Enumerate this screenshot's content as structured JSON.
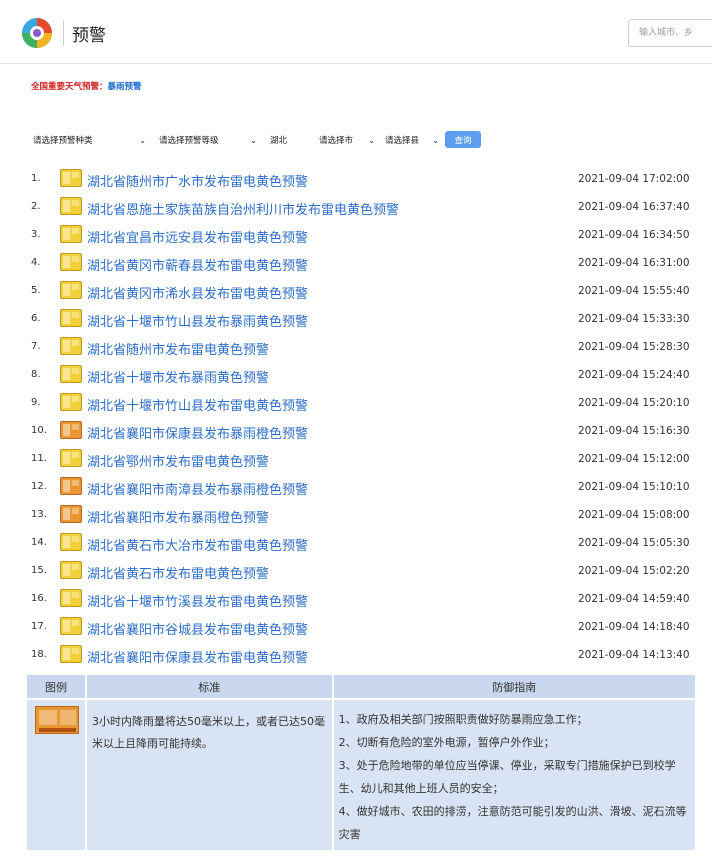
{
  "header": {
    "title": "预警",
    "search_placeholder": "输入城市、乡"
  },
  "national": {
    "label": "全国重要天气预警：",
    "link": "暴雨预警"
  },
  "filters": {
    "type": "请选择预警种类",
    "level": "请选择预警等级",
    "province": "湖北",
    "city": "请选择市",
    "county": "请选择县",
    "query": "查询"
  },
  "alerts": [
    {
      "num": "1.",
      "title": "湖北省随州市广水市发布雷电黄色预警",
      "time": "2021-09-04 17:02:00",
      "color": "yellow"
    },
    {
      "num": "2.",
      "title": "湖北省恩施土家族苗族自治州利川市发布雷电黄色预警",
      "time": "2021-09-04 16:37:40",
      "color": "yellow"
    },
    {
      "num": "3.",
      "title": "湖北省宜昌市远安县发布雷电黄色预警",
      "time": "2021-09-04 16:34:50",
      "color": "yellow"
    },
    {
      "num": "4.",
      "title": "湖北省黄冈市蕲春县发布雷电黄色预警",
      "time": "2021-09-04 16:31:00",
      "color": "yellow"
    },
    {
      "num": "5.",
      "title": "湖北省黄冈市浠水县发布雷电黄色预警",
      "time": "2021-09-04 15:55:40",
      "color": "yellow"
    },
    {
      "num": "6.",
      "title": "湖北省十堰市竹山县发布暴雨黄色预警",
      "time": "2021-09-04 15:33:30",
      "color": "yellow"
    },
    {
      "num": "7.",
      "title": "湖北省随州市发布雷电黄色预警",
      "time": "2021-09-04 15:28:30",
      "color": "yellow"
    },
    {
      "num": "8.",
      "title": "湖北省十堰市发布暴雨黄色预警",
      "time": "2021-09-04 15:24:40",
      "color": "yellow"
    },
    {
      "num": "9.",
      "title": "湖北省十堰市竹山县发布雷电黄色预警",
      "time": "2021-09-04 15:20:10",
      "color": "yellow"
    },
    {
      "num": "10.",
      "title": "湖北省襄阳市保康县发布暴雨橙色预警",
      "time": "2021-09-04 15:16:30",
      "color": "orange"
    },
    {
      "num": "11.",
      "title": "湖北省鄂州市发布雷电黄色预警",
      "time": "2021-09-04 15:12:00",
      "color": "yellow"
    },
    {
      "num": "12.",
      "title": "湖北省襄阳市南漳县发布暴雨橙色预警",
      "time": "2021-09-04 15:10:10",
      "color": "orange"
    },
    {
      "num": "13.",
      "title": "湖北省襄阳市发布暴雨橙色预警",
      "time": "2021-09-04 15:08:00",
      "color": "orange"
    },
    {
      "num": "14.",
      "title": "湖北省黄石市大冶市发布雷电黄色预警",
      "time": "2021-09-04 15:05:30",
      "color": "yellow"
    },
    {
      "num": "15.",
      "title": "湖北省黄石市发布雷电黄色预警",
      "time": "2021-09-04 15:02:20",
      "color": "yellow"
    },
    {
      "num": "16.",
      "title": "湖北省十堰市竹溪县发布雷电黄色预警",
      "time": "2021-09-04 14:59:40",
      "color": "yellow"
    },
    {
      "num": "17.",
      "title": "湖北省襄阳市谷城县发布雷电黄色预警",
      "time": "2021-09-04 14:18:40",
      "color": "yellow"
    },
    {
      "num": "18.",
      "title": "湖北省襄阳市保康县发布雷电黄色预警",
      "time": "2021-09-04 14:13:40",
      "color": "yellow"
    }
  ],
  "legend": {
    "headers": [
      "图例",
      "标准",
      "防御指南"
    ],
    "standard": "3小时内降雨量将达50毫米以上，或者已达50毫米以上且降雨可能持续。",
    "guide": [
      "1、政府及相关部门按照职责做好防暴雨应急工作；",
      "2、切断有危险的室外电源，暂停户外作业；",
      "3、处于危险地带的单位应当停课、停业，采取专门措施保护已到校学生、幼儿和其他上班人员的安全；",
      "4、做好城市、农田的排涝，注意防范可能引发的山洪、滑坡、泥石流等灾害"
    ]
  },
  "colors": {
    "link": "#2e6fc9",
    "national_label": "#d22323",
    "button": "#5c9ded",
    "yellow": "#f2d23b",
    "orange": "#e89732"
  }
}
